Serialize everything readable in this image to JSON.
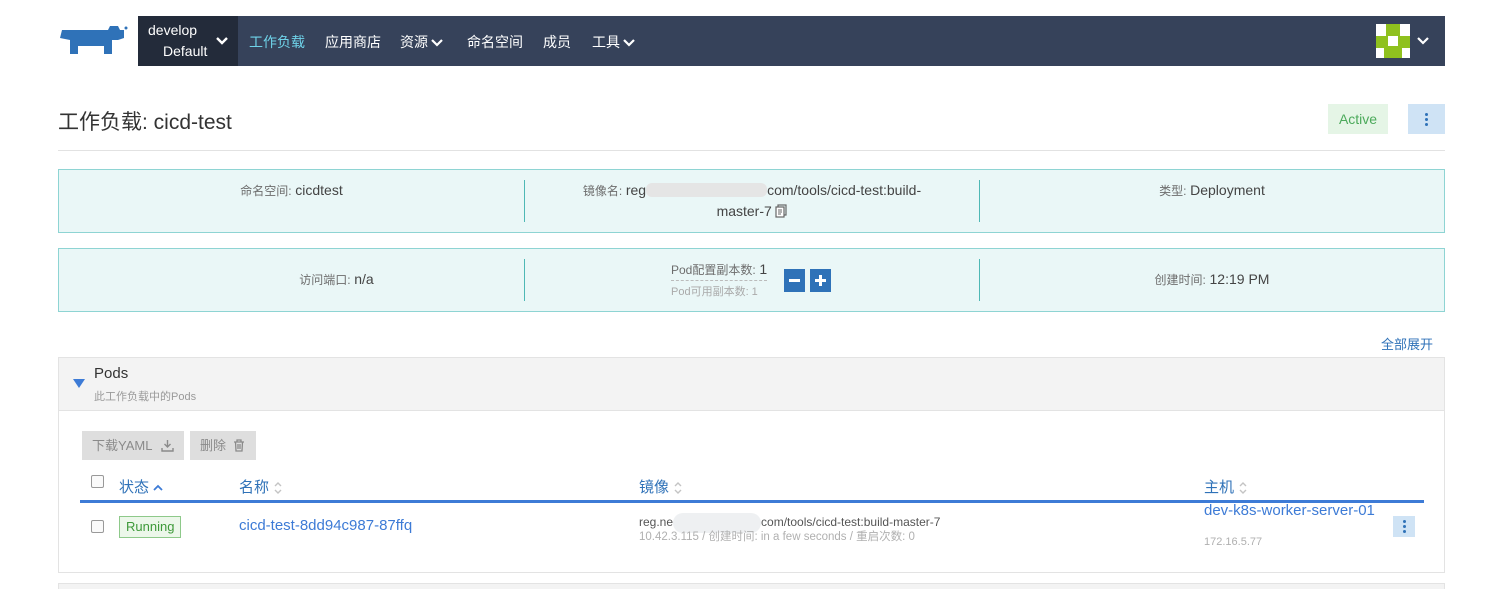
{
  "header": {
    "logo": "rancher-cow-logo",
    "cluster_name": "develop",
    "project_name": "Default",
    "nav": [
      "工作负载",
      "应用商店",
      "资源",
      "命名空间",
      "成员",
      "工具"
    ],
    "active_nav": "工作负载"
  },
  "page": {
    "title": "工作负载: cicd-test",
    "state": "Active"
  },
  "info": {
    "namespace_label": "命名空间:",
    "namespace_value": "cicdtest",
    "image_label": "镜像名:",
    "image_prefix": "reg",
    "image_suffix": "com/tools/cicd-test:build-",
    "image_line2": "master-7",
    "type_label": "类型:",
    "type_value": "Deployment",
    "port_label": "访问端口:",
    "port_value": "n/a",
    "replicas_label": "Pod配置副本数:",
    "replicas_value": "1",
    "available_label": "Pod可用副本数: 1",
    "created_label": "创建时间:",
    "created_value": "12:19 PM"
  },
  "expand_all": "全部展开",
  "pods": {
    "title": "Pods",
    "subtitle": "此工作负载中的Pods",
    "download_yaml": "下载YAML",
    "delete": "删除",
    "columns": [
      "状态",
      "名称",
      "镜像",
      "主机"
    ],
    "rows": [
      {
        "status": "Running",
        "name": "cicd-test-8dd94c987-87ffq",
        "image_prefix": "reg.ne",
        "image_suffix": "com/tools/cicd-test:build-master-7",
        "image_meta": "10.42.3.115 / 创建时间: in a few seconds / 重启次数: 0",
        "host": "dev-k8s-worker-server-01",
        "host_ip": "172.16.5.77"
      }
    ]
  },
  "colors": {
    "nav_bg": "#36425a",
    "nav_dark": "#232b3a",
    "link": "#3d7bd6",
    "active_green": "#4caa5b",
    "info_bg": "#eaf7f7"
  }
}
